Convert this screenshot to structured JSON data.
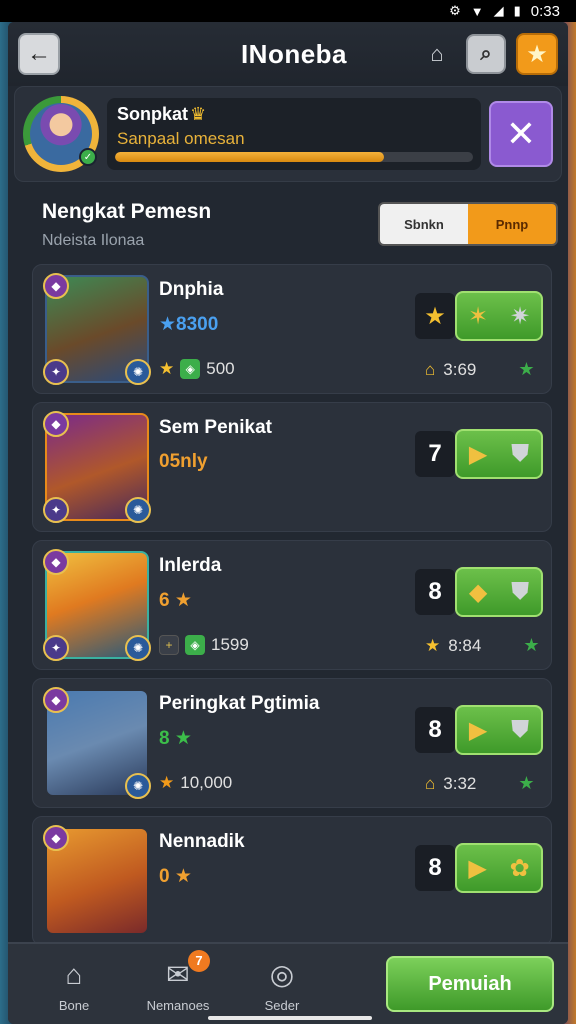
{
  "status": {
    "time": "0:33"
  },
  "header": {
    "title": "INoneba"
  },
  "profile": {
    "name": "Sonpkat",
    "subtitle": "Sanpaal omesan",
    "xp_progress": 0.75
  },
  "section": {
    "title": "Nengkat Pemesn",
    "subtitle": "Ndeista Ilonaa",
    "toggle": {
      "left": "Sbnkn",
      "right": "Pnnp"
    }
  },
  "cards": [
    {
      "name": "Dnphia",
      "line2": "★8300",
      "line2_color": "blue",
      "stats": "500",
      "rank": "",
      "right_value": "3:69"
    },
    {
      "name": "Sem Penikat",
      "line2": "05nly",
      "line2_color": "orange",
      "stats": "",
      "rank": "7",
      "right_value": ""
    },
    {
      "name": "Inlerda",
      "line2": "6 ★",
      "line2_color": "orange",
      "stats": "1599",
      "rank": "8",
      "right_value": "8:84"
    },
    {
      "name": "Peringkat Pgtimia",
      "line2": "8 ★",
      "line2_color": "green",
      "stats": "10,000",
      "rank": "8",
      "right_value": "3:32"
    },
    {
      "name": "Nennadik",
      "line2": "0 ★",
      "line2_color": "orange",
      "stats": "",
      "rank": "8",
      "right_value": ""
    }
  ],
  "nav": {
    "items": [
      {
        "label": "Bone",
        "icon": "home-icon"
      },
      {
        "label": "Nemanoes",
        "icon": "chat-icon",
        "badge": "7"
      },
      {
        "label": "Seder",
        "icon": "target-icon"
      }
    ],
    "primary": "Pemuiah"
  },
  "colors": {
    "accent_orange": "#f29a1a",
    "accent_green": "#3f9a2a",
    "accent_purple": "#8a5ad0",
    "background": "#222831"
  }
}
